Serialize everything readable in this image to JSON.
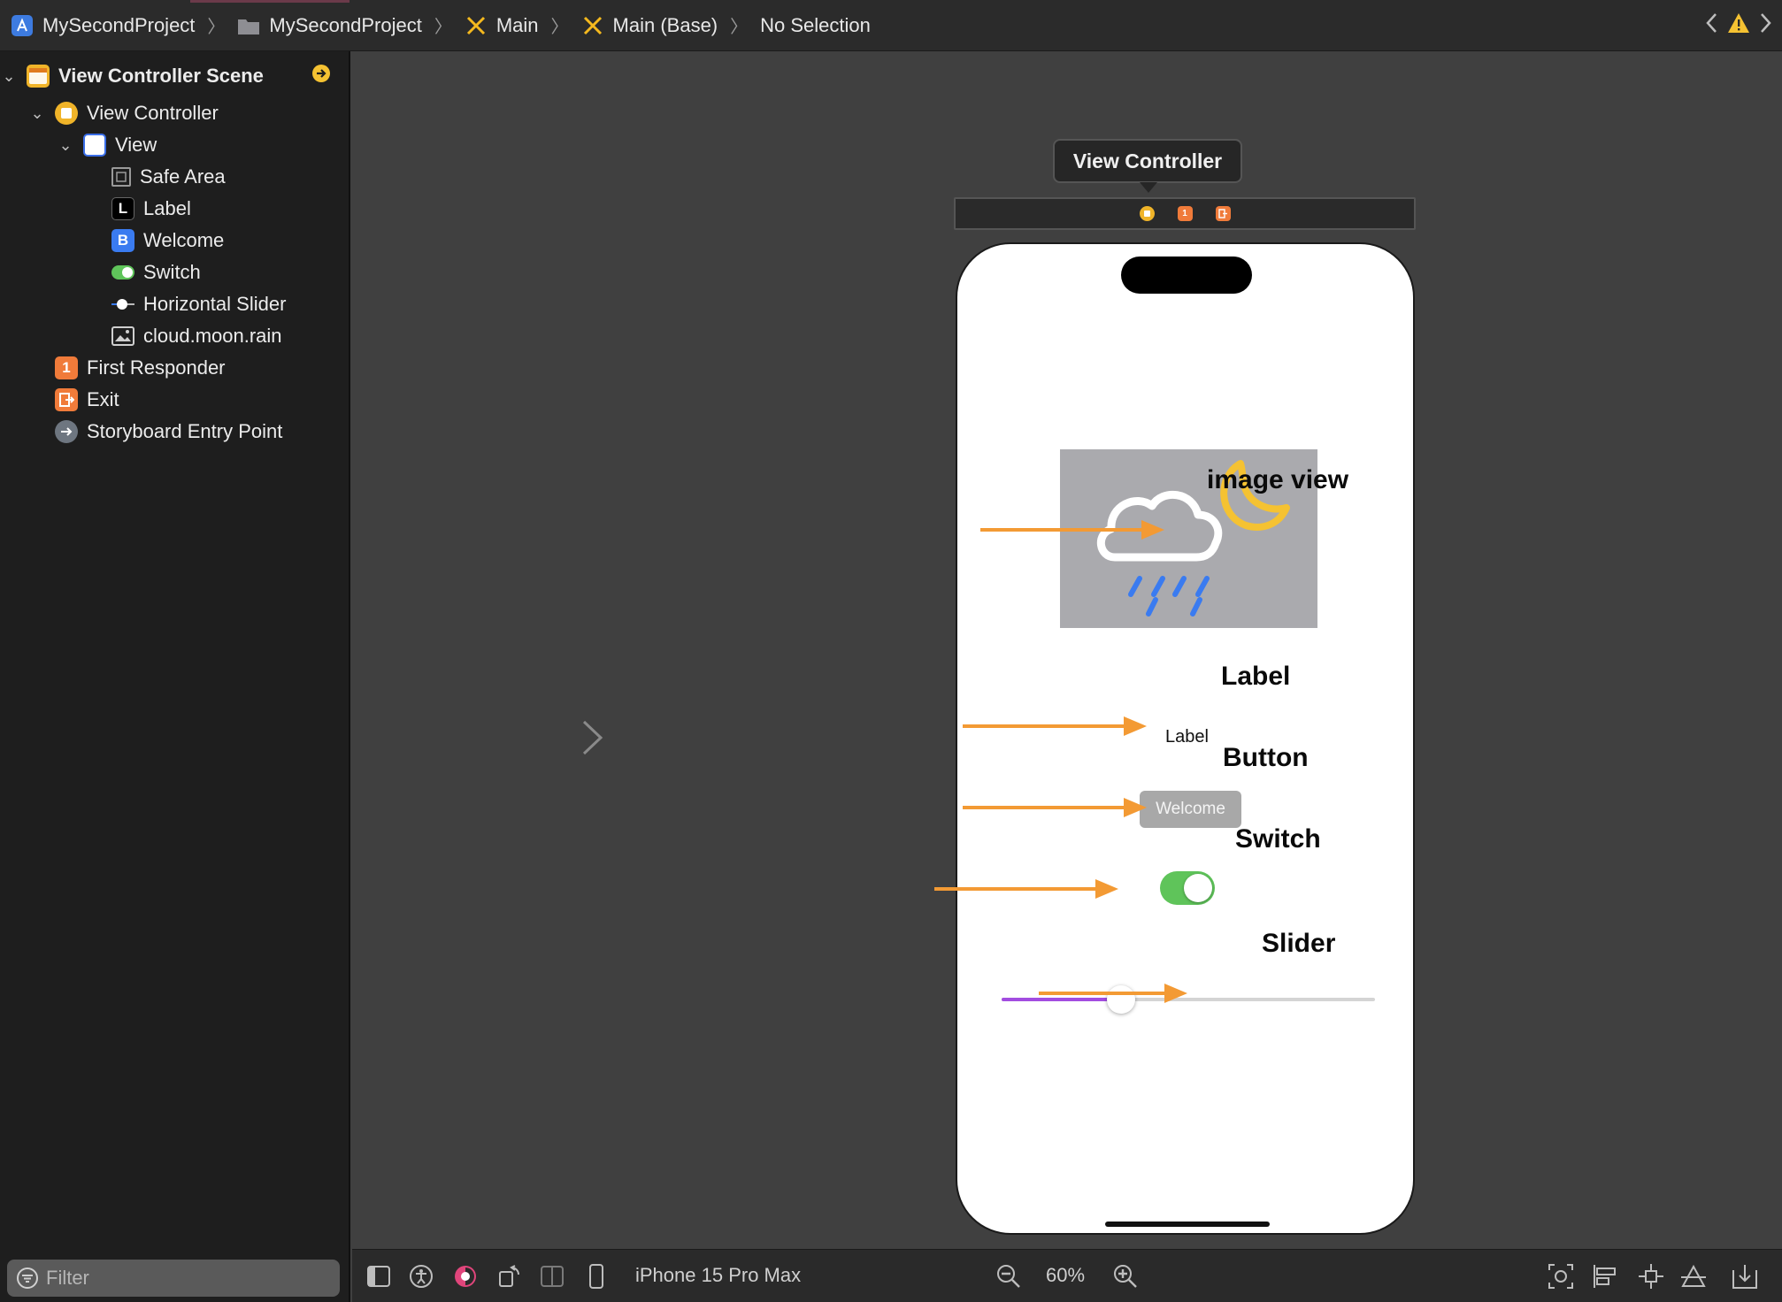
{
  "breadcrumb": {
    "project": "MySecondProject",
    "folder": "MySecondProject",
    "storyboard": "Main",
    "localization": "Main (Base)",
    "selection": "No Selection"
  },
  "outline": {
    "scene": "View Controller Scene",
    "view_controller": "View Controller",
    "view": "View",
    "safe_area": "Safe Area",
    "label": "Label",
    "welcome": "Welcome",
    "switch": "Switch",
    "slider": "Horizontal Slider",
    "image": "cloud.moon.rain",
    "first_responder": "First Responder",
    "exit": "Exit",
    "entry_point": "Storyboard Entry Point",
    "label_icon_letter": "L",
    "button_icon_letter": "B",
    "responder_icon_letter": "1"
  },
  "filter": {
    "placeholder": "Filter"
  },
  "canvas": {
    "tooltip": "View Controller",
    "ui_label": "Label",
    "ui_button": "Welcome",
    "switch_on": true,
    "slider_value": 0.32,
    "image_symbol": "cloud-moon-rain-icon"
  },
  "annotations": {
    "image_view": "image view",
    "label": "Label",
    "button": "Button",
    "switch": "Switch",
    "slider": "Slider"
  },
  "bottom_bar": {
    "device": "iPhone 15 Pro Max",
    "zoom": "60%"
  },
  "colors": {
    "arrow": "#f39a34",
    "switch_on": "#5fc45a",
    "slider_fill": "#a24ce0",
    "warning": "#f5c232"
  }
}
